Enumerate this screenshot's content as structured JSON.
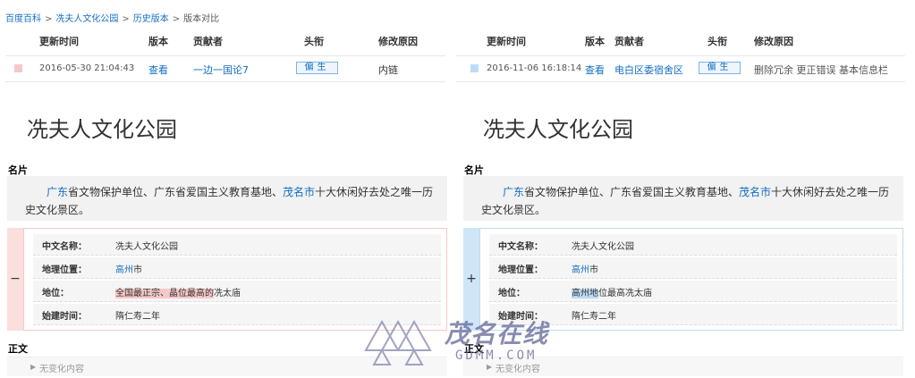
{
  "breadcrumb": {
    "items": [
      "百度百科",
      "冼夫人文化公园",
      "历史版本",
      "版本对比"
    ],
    "separator": ">"
  },
  "table_headers": {
    "time": "更新时间",
    "version": "版本",
    "contributor": "贡献者",
    "title": "头衔",
    "reason": "修改原因"
  },
  "left": {
    "marker_color": "#f7c8c8",
    "time": "2016-05-30 21:04:43",
    "view": "查看",
    "contributor": "一边一国论7",
    "title_tag": "偏生",
    "reason": "内链",
    "page_title": "冼夫人文化公园",
    "card_label": "名片",
    "summary": {
      "link1": "广东",
      "text1": "省文物保护单位、广东省爱国主义教育基地、",
      "link2": "茂名市",
      "text2": "十大休闲好去处之唯一历史文化景区。"
    },
    "side_symbol": "−",
    "frame_color": "#f7c8c8",
    "side_color": "#fbdede",
    "info": {
      "name_key": "中文名称：",
      "name_val": "冼夫人文化公园",
      "loc_key": "地理位置：",
      "loc_link": "高州",
      "loc_rest": "市",
      "status_key": "地位：",
      "status_hl": "全国最正宗、晶位最高的",
      "status_rest": "冼太庙",
      "start_key": "始建时间：",
      "start_val": "隋仁寿二年"
    },
    "body_label": "正文",
    "collapsed": "无变化内容"
  },
  "right": {
    "marker_color": "#bcdcf4",
    "time": "2016-11-06 16:18:14",
    "view": "查看",
    "contributor": "电白区委宿舍区",
    "title_tag": "偏生",
    "reason": "删除冗余 更正错误 基本信息栏",
    "page_title": "冼夫人文化公园",
    "card_label": "名片",
    "summary": {
      "link1": "广东",
      "text1": "省文物保护单位、广东省爱国主义教育基地、",
      "link2": "茂名市",
      "text2": "十大休闲好去处之唯一历史文化景区。"
    },
    "side_symbol": "+",
    "frame_color": "#bcdcf4",
    "side_color": "#cfe6f8",
    "info": {
      "name_key": "中文名称：",
      "name_val": "冼夫人文化公园",
      "loc_key": "地理位置：",
      "loc_link": "高州",
      "loc_rest": "市",
      "status_key": "地位：",
      "status_hl": "高州地",
      "status_rest": "位最高冼太庙",
      "start_key": "始建时间：",
      "start_val": "隋仁寿二年"
    },
    "body_label": "正文",
    "collapsed": "无变化内容"
  },
  "watermark": {
    "text": "茂名在线",
    "sub": "GDMM.COM"
  }
}
